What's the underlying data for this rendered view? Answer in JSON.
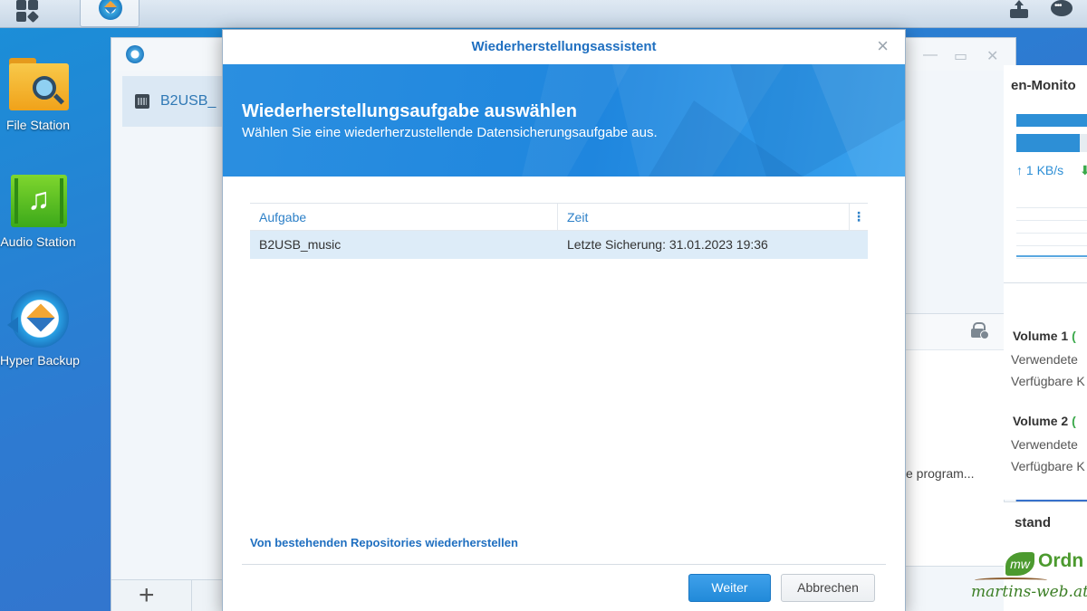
{
  "taskbar": {
    "menu_icon": "grid-menu-icon",
    "active_app_icon": "hyper-backup-icon",
    "upload_icon": "upload-icon",
    "chat_icon": "chat-bubble-icon"
  },
  "desktop": {
    "icons": [
      {
        "label": "File Station",
        "icon": "file-station-icon"
      },
      {
        "label": "Audio Station",
        "icon": "audio-station-icon"
      },
      {
        "label": "Hyper Backup",
        "icon": "hyper-backup-icon"
      }
    ]
  },
  "background_window": {
    "task_name": "B2USB_",
    "panel_text": "e program...",
    "add_label": "+"
  },
  "widget": {
    "title": "en-Monito",
    "speed": "1 KB/s",
    "volumes": [
      {
        "name": "Volume 1",
        "suffix": "(",
        "used": "Verwendete",
        "free": "Verfügbare K"
      },
      {
        "name": "Volume 2",
        "suffix": "(",
        "used": "Verwendete",
        "free": "Verfügbare K"
      }
    ],
    "status_title": "stand"
  },
  "watermark": {
    "badge": "mw",
    "word": "Ordn",
    "site": "martins-web.at"
  },
  "dialog": {
    "title": "Wiederherstellungsassistent",
    "close": "×",
    "heading": "Wiederherstellungsaufgabe auswählen",
    "subheading": "Wählen Sie eine wiederherzustellende Datensicherungsaufgabe aus.",
    "table": {
      "columns": [
        "Aufgabe",
        "Zeit"
      ],
      "menu": "⋮",
      "rows": [
        {
          "task": "B2USB_music",
          "time": "Letzte Sicherung: 31.01.2023 19:36"
        }
      ]
    },
    "repo_link": "Von bestehenden Repositories wiederherstellen",
    "buttons": {
      "next": "Weiter",
      "cancel": "Abbrechen"
    },
    "colors": {
      "accent": "#1f6fc0",
      "banner": "#1f86de",
      "selected_row": "#ddecf8"
    }
  }
}
